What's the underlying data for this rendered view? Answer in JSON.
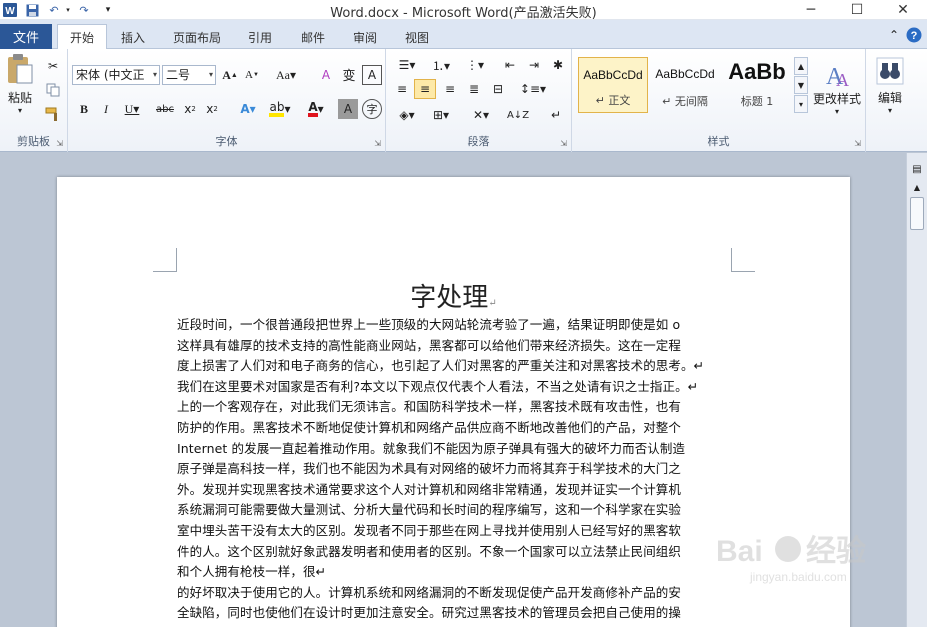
{
  "window": {
    "title": "Word.docx  -  Microsoft Word(产品激活失败)"
  },
  "quick_access": {
    "icons": [
      "word-logo-icon",
      "save-icon",
      "undo-icon",
      "redo-icon",
      "customize-icon"
    ]
  },
  "tabs": [
    {
      "label": "文件"
    },
    {
      "label": "开始"
    },
    {
      "label": "插入"
    },
    {
      "label": "页面布局"
    },
    {
      "label": "引用"
    },
    {
      "label": "邮件"
    },
    {
      "label": "审阅"
    },
    {
      "label": "视图"
    }
  ],
  "ribbon": {
    "clipboard": {
      "paste_label": "粘贴",
      "group_label": "剪贴板"
    },
    "font": {
      "font_name": "宋体 (中文正",
      "font_size": "二号",
      "group_label": "字体"
    },
    "paragraph": {
      "group_label": "段落"
    },
    "styles": {
      "group_label": "样式",
      "items": [
        {
          "sample": "AaBbCcDd",
          "name": "↵ 正文"
        },
        {
          "sample": "AaBbCcDd",
          "name": "↵ 无间隔"
        },
        {
          "sample": "AaBb",
          "name": "标题 1"
        }
      ],
      "change_styles_label": "更改样式"
    },
    "editing": {
      "label": "编辑"
    }
  },
  "document": {
    "title": "字处理",
    "lines": [
      "近段时间，一个很普通段把世界上一些顶级的大网站轮流考验了一遍，结果证明即使是如 o",
      "这样具有雄厚的技术支持的高性能商业网站，黑客都可以给他们带来经济损失。这在一定程",
      "度上损害了人们对和电子商务的信心，也引起了人们对黑客的严重关注和对黑客技术的思考。↵",
      "我们在这里要术对国家是否有利?本文以下观点仅代表个人看法，不当之处请有识之士指正。↵",
      "上的一个客观存在，对此我们无须讳言。和国防科学技术一样，黑客技术既有攻击性，也有",
      "防护的作用。黑客技术不断地促使计算机和网络产品供应商不断地改善他们的产品，对整个",
      "Internet 的发展一直起着推动作用。就象我们不能因为原子弹具有强大的破坏力而否认制造",
      "原子弹是高科技一样，我们也不能因为术具有对网络的破坏力而将其弃于科学技术的大门之",
      "外。发现并实现黑客技术通常要求这个人对计算机和网络非常精通，发现并证实一个计算机",
      "系统漏洞可能需要做大量测试、分析大量代码和长时间的程序编写，这和一个科学家在实验",
      "室中埋头苦干没有太大的区别。发现者不同于那些在网上寻找并使用别人已经写好的黑客软",
      "件的人。这个区别就好象武器发明者和使用者的区别。不象一个国家可以立法禁止民间组织",
      "和个人拥有枪枝一样，很↵",
      "的好坏取决于使用它的人。计算机系统和网络漏洞的不断发现促使产品开发商修补产品的安",
      "全缺陷，同时也使他们在设计时更加注意安全。研究过黑客技术的管理员会把自己使用的操"
    ]
  },
  "watermark": {
    "text": "Baidu 经验",
    "sub": "jingyan.baidu.com"
  }
}
